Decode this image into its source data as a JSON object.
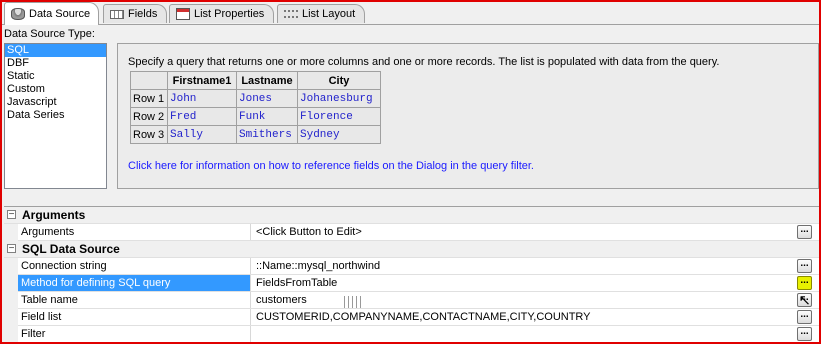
{
  "tabs": [
    {
      "label": "Data Source",
      "icon": "database-icon",
      "active": true
    },
    {
      "label": "Fields",
      "icon": "fields-icon"
    },
    {
      "label": "List Properties",
      "icon": "list-properties-icon"
    },
    {
      "label": "List Layout",
      "icon": "list-layout-icon"
    }
  ],
  "source_type": {
    "label": "Data Source Type:",
    "items": [
      "SQL",
      "DBF",
      "Static",
      "Custom",
      "Javascript",
      "Data Series"
    ],
    "selected": "SQL"
  },
  "description": {
    "text": "Specify a query that returns one or more columns and one or more records. The list is populated with data from the query.",
    "table": {
      "headers": [
        "",
        "Firstname1",
        "Lastname",
        "City"
      ],
      "rows": [
        [
          "Row 1",
          "John",
          "Jones",
          "Johanesburg"
        ],
        [
          "Row 2",
          "Fred",
          "Funk",
          "Florence"
        ],
        [
          "Row 3",
          "Sally",
          "Smithers",
          "Sydney"
        ]
      ]
    },
    "help_link": "Click here for information on how to reference fields on the Dialog in the query filter."
  },
  "properties": {
    "arguments_category": "Arguments",
    "arguments": {
      "name": "Arguments",
      "value": "<Click Button to Edit>"
    },
    "sql_category": "SQL Data Source",
    "connection_string": {
      "name": "Connection string",
      "value": "::Name::mysql_northwind"
    },
    "method": {
      "name": "Method for defining SQL query",
      "value": "FieldsFromTable"
    },
    "table_name": {
      "name": "Table name",
      "value": "customers"
    },
    "field_list": {
      "name": "Field list",
      "value": "CUSTOMERID,COMPANYNAME,CONTACTNAME,CITY,COUNTRY"
    },
    "filter": {
      "name": "Filter",
      "value": ""
    },
    "ellipsis": "..."
  },
  "colors": {
    "selection": "#3399ff",
    "link": "#1a1aff",
    "highlight_button": "#e8f000",
    "frame": "#e00000"
  }
}
